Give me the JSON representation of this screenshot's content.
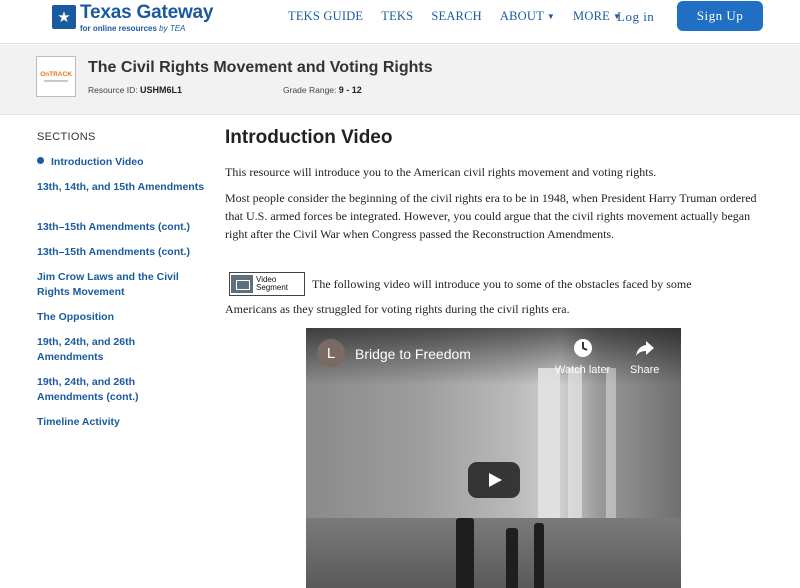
{
  "header": {
    "logo_title": "Texas Gateway",
    "logo_sub": "for online resources",
    "logo_sub_by": "by TEA",
    "nav": [
      {
        "label": "TEKS GUIDE",
        "has_caret": false
      },
      {
        "label": "TEKS",
        "has_caret": false
      },
      {
        "label": "SEARCH",
        "has_caret": false
      },
      {
        "label": "ABOUT",
        "has_caret": true
      },
      {
        "label": "MORE",
        "has_caret": true
      }
    ],
    "login_label": "Log in",
    "signup_label": "Sign Up",
    "accent_color": "#1a5a9e",
    "signup_color": "#1f6fc5"
  },
  "resource": {
    "thumb_logo": "OnTRACK",
    "title": "The Civil Rights Movement and Voting Rights",
    "id_label": "Resource ID:",
    "id_value": "USHM6L1",
    "grade_label": "Grade Range:",
    "grade_value": "9 - 12"
  },
  "sidebar": {
    "heading": "SECTIONS",
    "items": [
      {
        "label": "Introduction Video",
        "active": true
      },
      {
        "label": "13th, 14th, and 15th Amendments",
        "active": false
      },
      {
        "label": "13th–15th Amendments (cont.)",
        "active": false
      },
      {
        "label": "13th–15th Amendments (cont.)",
        "active": false
      },
      {
        "label": "Jim Crow Laws and the Civil Rights Movement",
        "active": false
      },
      {
        "label": "The Opposition",
        "active": false
      },
      {
        "label": "19th, 24th, and 26th Amendments",
        "active": false
      },
      {
        "label": "19th, 24th, and 26th Amendments (cont.)",
        "active": false
      },
      {
        "label": "Timeline Activity",
        "active": false
      }
    ]
  },
  "main": {
    "title": "Introduction Video",
    "para1": "This resource will introduce you to the American civil rights movement and voting rights.",
    "para2": "Most people consider the beginning of the civil rights era to be in 1948, when President Harry Truman ordered that U.S. armed forces be integrated. However, you could argue that the civil rights movement actually began right after the Civil War when Congress passed the Reconstruction Amendments.",
    "badge_line1": "Video",
    "badge_line2": "Segment",
    "para3_first": "The following video will introduce you to some of the obstacles faced by some",
    "para3_rest": "Americans as they struggled for voting rights during the civil rights era."
  },
  "video": {
    "channel_initial": "L",
    "title": "Bridge to Freedom",
    "watch_later": "Watch later",
    "share": "Share",
    "icons": {
      "watch_later": "clock-icon",
      "share": "share-arrow-icon",
      "play": "play-icon"
    }
  }
}
